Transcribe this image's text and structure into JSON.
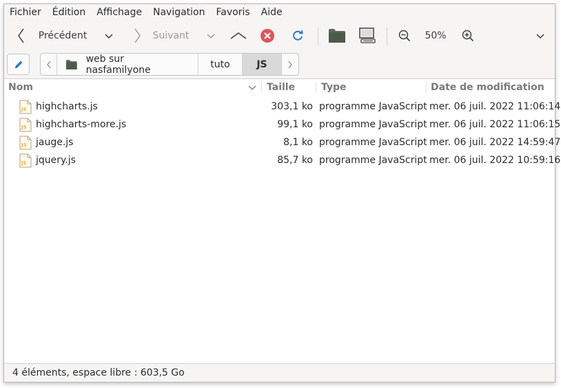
{
  "menubar": {
    "items": [
      "Fichier",
      "Édition",
      "Affichage",
      "Navigation",
      "Favoris",
      "Aide"
    ]
  },
  "toolbar": {
    "back_label": "Précédent",
    "forward_label": "Suivant",
    "zoom_level": "50%"
  },
  "pathbar": {
    "crumbs": [
      "web sur nasfamilyone",
      "tuto",
      "JS"
    ]
  },
  "columns": {
    "name": "Nom",
    "size": "Taille",
    "type": "Type",
    "date": "Date de modification"
  },
  "files": [
    {
      "name": "highcharts.js",
      "size": "303,1 ko",
      "type": "programme JavaScript",
      "date": "mer. 06 juil. 2022 11:06:14",
      "icon_text": "JS"
    },
    {
      "name": "highcharts-more.js",
      "size": "99,1 ko",
      "type": "programme JavaScript",
      "date": "mer. 06 juil. 2022 11:06:15",
      "icon_text": "JS"
    },
    {
      "name": "jauge.js",
      "size": "8,1 ko",
      "type": "programme JavaScript",
      "date": "mer. 06 juil. 2022 14:59:47",
      "icon_text": "JS"
    },
    {
      "name": "jquery.js",
      "size": "85,7 ko",
      "type": "programme JavaScript",
      "date": "mer. 06 juil. 2022 10:59:16",
      "icon_text": "JS"
    }
  ],
  "status": {
    "text": "4 éléments, espace libre : 603,5 Go"
  },
  "colors": {
    "close_red": "#e0535a",
    "reload_blue": "#2a7bd4",
    "folder_green": "#5b6b57",
    "js_yellow": "#e8b43a"
  }
}
